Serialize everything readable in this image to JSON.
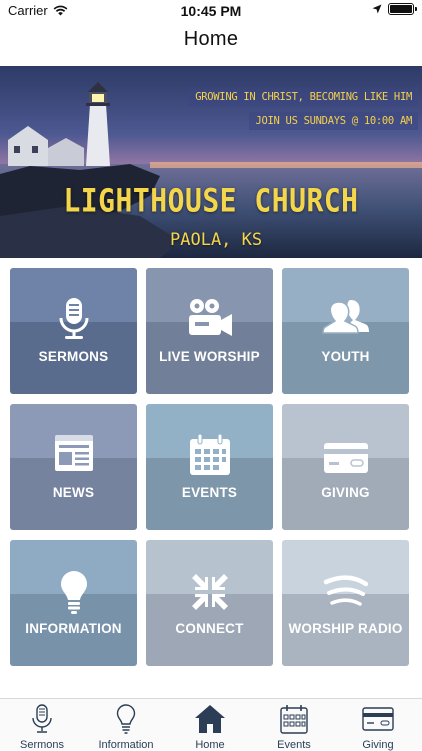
{
  "status_bar": {
    "carrier": "Carrier",
    "time": "10:45 PM"
  },
  "nav": {
    "title": "Home"
  },
  "hero": {
    "tagline_1": "GROWING IN CHRIST, BECOMING LIKE HIM",
    "tagline_2": "JOIN US SUNDAYS @ 10:00 AM",
    "church_name": "LIGHTHOUSE CHURCH",
    "church_city": "PAOLA, KS"
  },
  "tiles": [
    {
      "label": "SERMONS",
      "icon": "microphone-icon",
      "top_color": "#6f82a8",
      "bottom_color": "#5a6c8e"
    },
    {
      "label": "LIVE WORSHIP",
      "icon": "video-camera-icon",
      "top_color": "#8795ae",
      "bottom_color": "#727f98"
    },
    {
      "label": "YOUTH",
      "icon": "people-icon",
      "top_color": "#97afc4",
      "bottom_color": "#7f97ab"
    },
    {
      "label": "NEWS",
      "icon": "newspaper-icon",
      "top_color": "#8c9ab8",
      "bottom_color": "#76839e"
    },
    {
      "label": "EVENTS",
      "icon": "calendar-icon",
      "top_color": "#92b0c6",
      "bottom_color": "#7d96aa"
    },
    {
      "label": "GIVING",
      "icon": "credit-card-icon",
      "top_color": "#b9c3cf",
      "bottom_color": "#a1aab7"
    },
    {
      "label": "INFORMATION",
      "icon": "lightbulb-icon",
      "top_color": "#8eabc3",
      "bottom_color": "#7892a9"
    },
    {
      "label": "CONNECT",
      "icon": "arrows-inward-icon",
      "top_color": "#b7c2cf",
      "bottom_color": "#9da7b6"
    },
    {
      "label": "WORSHIP RADIO",
      "icon": "radio-waves-icon",
      "top_color": "#c9d3de",
      "bottom_color": "#aab4c1"
    }
  ],
  "tab_bar": {
    "items": [
      {
        "label": "Sermons",
        "icon": "microphone-icon"
      },
      {
        "label": "Information",
        "icon": "lightbulb-icon"
      },
      {
        "label": "Home",
        "icon": "house-icon",
        "active": true
      },
      {
        "label": "Events",
        "icon": "calendar-icon"
      },
      {
        "label": "Giving",
        "icon": "credit-card-icon"
      }
    ]
  },
  "colors": {
    "accent": "#2b3e55",
    "hero_text": "#f4d64a"
  }
}
